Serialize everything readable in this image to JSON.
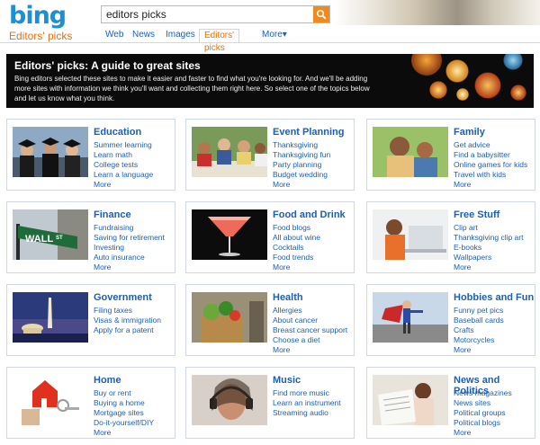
{
  "header": {
    "logo": "bing",
    "section": "Editors' picks",
    "search_value": "editors picks",
    "scopes": [
      "Web",
      "News",
      "Images",
      "Editors' picks",
      "More▾"
    ],
    "active_scope": "Editors' picks"
  },
  "banner": {
    "title": "Editors' picks: A guide to great sites",
    "text": "Bing editors selected these sites to make it easier and faster to find what you're looking for. And we'll be adding more sites with information we think you'll want and collecting them right here. So select one of the topics below and let us know what you think."
  },
  "colors": {
    "link": "#1c5fb2",
    "accent": "#e8700c",
    "brand": "#1d8fd4",
    "card_border": "#cfd8e4"
  },
  "categories": [
    {
      "title": "Education",
      "image": "graduates-photo",
      "links": [
        "Summer learning",
        "Learn math",
        "College tests",
        "Learn a language",
        "More"
      ]
    },
    {
      "title": "Event Planning",
      "image": "party-photo",
      "links": [
        "Thanksgiving",
        "Thanksgiving fun",
        "Party planning",
        "Budget wedding",
        "More"
      ]
    },
    {
      "title": "Family",
      "image": "family-photo",
      "links": [
        "Get advice",
        "Find a babysitter",
        "Online games for kids",
        "Travel with kids",
        "More"
      ]
    },
    {
      "title": "Finance",
      "image": "wall-street-sign-photo",
      "links": [
        "Fundraising",
        "Saving for retirement",
        "Investing",
        "Auto insurance",
        "More"
      ]
    },
    {
      "title": "Food and Drink",
      "image": "cocktail-photo",
      "links": [
        "Food blogs",
        "All about wine",
        "Cocktails",
        "Food trends",
        "More"
      ]
    },
    {
      "title": "Free Stuff",
      "image": "woman-laptop-photo",
      "links": [
        "Clip art",
        "Thanksgiving clip art",
        "E-books",
        "Wallpapers",
        "More"
      ]
    },
    {
      "title": "Government",
      "image": "capitol-photo",
      "links": [
        "Filing taxes",
        "Visas & immigration",
        "Apply for a patent"
      ]
    },
    {
      "title": "Health",
      "image": "vegetable-basket-photo",
      "links": [
        "Allergies",
        "About cancer",
        "Breast cancer support",
        "Choose a diet",
        "More"
      ]
    },
    {
      "title": "Hobbies and Fun",
      "image": "superhero-photo",
      "links": [
        "Funny pet pics",
        "Baseball cards",
        "Crafts",
        "Motorcycles",
        "More"
      ]
    },
    {
      "title": "Home",
      "image": "house-keys-photo",
      "links": [
        "Buy or rent",
        "Buying a home",
        "Mortgage sites",
        "Do-it-yourself/DIY",
        "More"
      ]
    },
    {
      "title": "Music",
      "image": "headphones-photo",
      "links": [
        "Find more music",
        "Learn an instrument",
        "Streaming audio"
      ]
    },
    {
      "title": "News and Politics",
      "image": "newspaper-reader-photo",
      "links": [
        "News magazines",
        "News sites",
        "Political groups",
        "Political blogs",
        "More"
      ]
    }
  ]
}
